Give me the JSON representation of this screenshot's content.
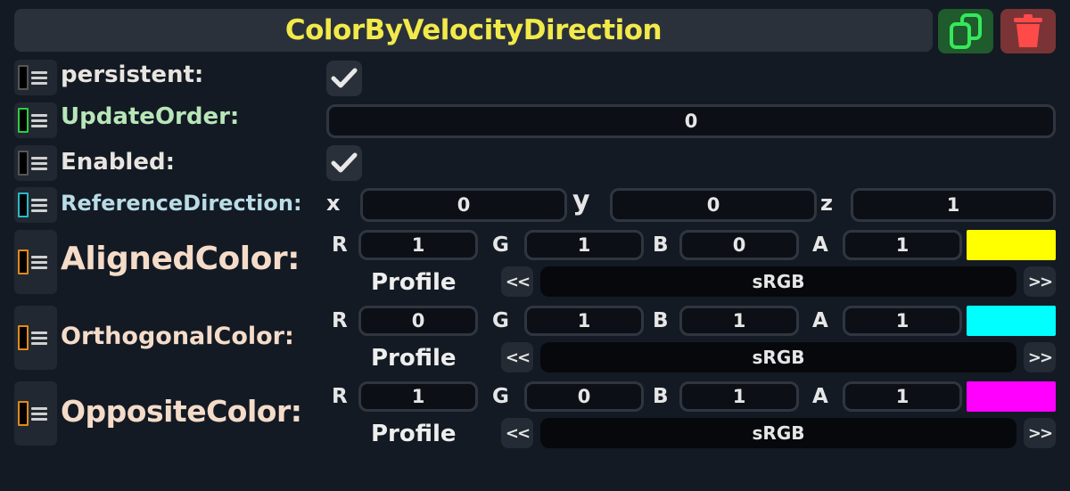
{
  "header": {
    "title": "ColorByVelocityDirection",
    "copy_icon": "copy-icon",
    "delete_icon": "trash-icon",
    "title_color": "#f2ea4a"
  },
  "rows": {
    "persistent": {
      "label": "persistent:",
      "checked": true
    },
    "update_order": {
      "label": "UpdateOrder:",
      "value": "0",
      "label_color": "#b8e6b8"
    },
    "enabled": {
      "label": "Enabled:",
      "checked": true
    },
    "reference_direction": {
      "label": "ReferenceDirection:",
      "label_color": "#b9dce6",
      "x_label": "x",
      "x": "0",
      "y_label": "y",
      "y": "0",
      "z_label": "z",
      "z": "1"
    }
  },
  "colors": [
    {
      "label": "AlignedColor:",
      "r_label": "R",
      "r": "1",
      "g_label": "G",
      "g": "1",
      "b_label": "B",
      "b": "0",
      "a_label": "A",
      "a": "1",
      "swatch": "#ffff00",
      "profile_label": "Profile",
      "prev": "<<",
      "profile": "sRGB",
      "next": ">>"
    },
    {
      "label": "OrthogonalColor:",
      "r_label": "R",
      "r": "0",
      "g_label": "G",
      "g": "1",
      "b_label": "B",
      "b": "1",
      "a_label": "A",
      "a": "1",
      "swatch": "#00ffff",
      "profile_label": "Profile",
      "prev": "<<",
      "profile": "sRGB",
      "next": ">>"
    },
    {
      "label": "OppositeColor:",
      "r_label": "R",
      "r": "1",
      "g_label": "G",
      "g": "0",
      "b_label": "B",
      "b": "1",
      "a_label": "A",
      "a": "1",
      "swatch": "#ff00ff",
      "profile_label": "Profile",
      "prev": "<<",
      "profile": "sRGB",
      "next": ">>"
    }
  ]
}
